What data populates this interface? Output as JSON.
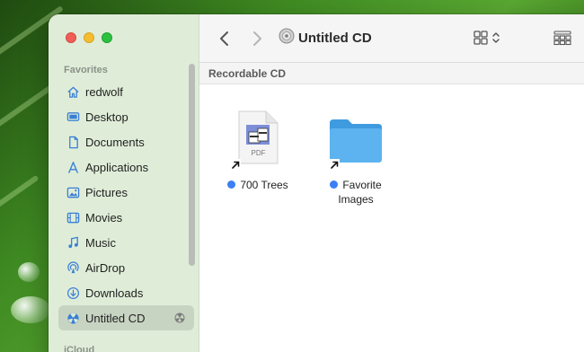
{
  "window": {
    "title": "Untitled CD",
    "traffic_lights": [
      "close",
      "minimize",
      "zoom"
    ]
  },
  "sidebar": {
    "sections": [
      {
        "label": "Favorites",
        "items": [
          {
            "label": "redwolf",
            "icon": "house-icon"
          },
          {
            "label": "Desktop",
            "icon": "desktop-icon"
          },
          {
            "label": "Documents",
            "icon": "document-icon"
          },
          {
            "label": "Applications",
            "icon": "applications-icon"
          },
          {
            "label": "Pictures",
            "icon": "pictures-icon"
          },
          {
            "label": "Movies",
            "icon": "film-icon"
          },
          {
            "label": "Music",
            "icon": "music-note-icon"
          },
          {
            "label": "AirDrop",
            "icon": "airdrop-icon"
          },
          {
            "label": "Downloads",
            "icon": "download-icon"
          },
          {
            "label": "Untitled CD",
            "icon": "burn-disc-icon",
            "selected": true,
            "ejectable": true
          }
        ]
      },
      {
        "label": "iCloud",
        "items": []
      }
    ]
  },
  "toolbar": {
    "back_icon": "chevron-left-icon",
    "forward_icon": "chevron-right-icon",
    "title_icon": "cd-icon",
    "view_icon": "icon-grid-icon",
    "group_icon": "group-grid-icon"
  },
  "pathbar": {
    "label": "Recordable CD"
  },
  "files": [
    {
      "name": "700 Trees",
      "kind": "pdf",
      "icon": "pdf-file-icon",
      "icon_label": "PDF",
      "tag_color": "#3b7ff5",
      "alias": true
    },
    {
      "name": "Favorite Images",
      "kind": "folder",
      "icon": "folder-icon",
      "tag_color": "#3b7ff5",
      "alias": true
    }
  ],
  "colors": {
    "accent_blue": "#3b7ff5",
    "folder_blue": "#4ea5e8",
    "sidebar_bg": "#deecd6"
  }
}
